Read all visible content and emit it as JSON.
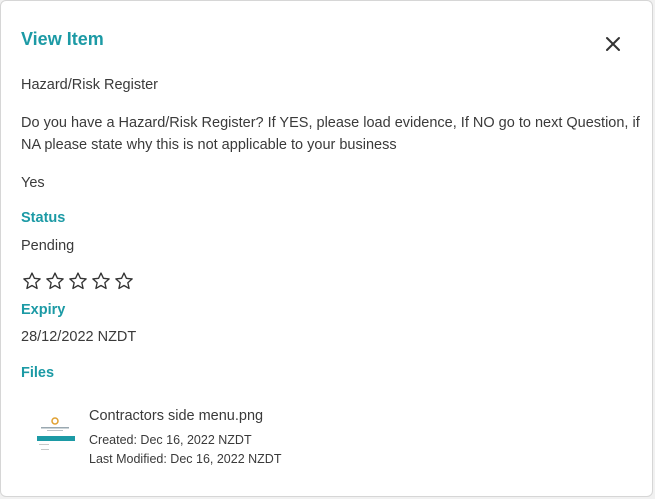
{
  "dialog": {
    "title": "View Item",
    "close_icon": "close-icon"
  },
  "item": {
    "name": "Hazard/Risk Register",
    "question": "Do you have a Hazard/Risk Register? If YES, please load evidence, If NO go to next Question, if NA please state why this is not applicable to your business",
    "answer": "Yes",
    "status_label": "Status",
    "status_value": "Pending",
    "rating": 0,
    "rating_max": 5,
    "expiry_label": "Expiry",
    "expiry_value": "28/12/2022 NZDT",
    "files_label": "Files"
  },
  "files": [
    {
      "name": "Contractors side menu.png",
      "created": "Created: Dec 16, 2022 NZDT",
      "modified": "Last Modified: Dec 16, 2022 NZDT"
    }
  ],
  "colors": {
    "accent": "#1c9aa5",
    "text": "#3a3a3a"
  }
}
